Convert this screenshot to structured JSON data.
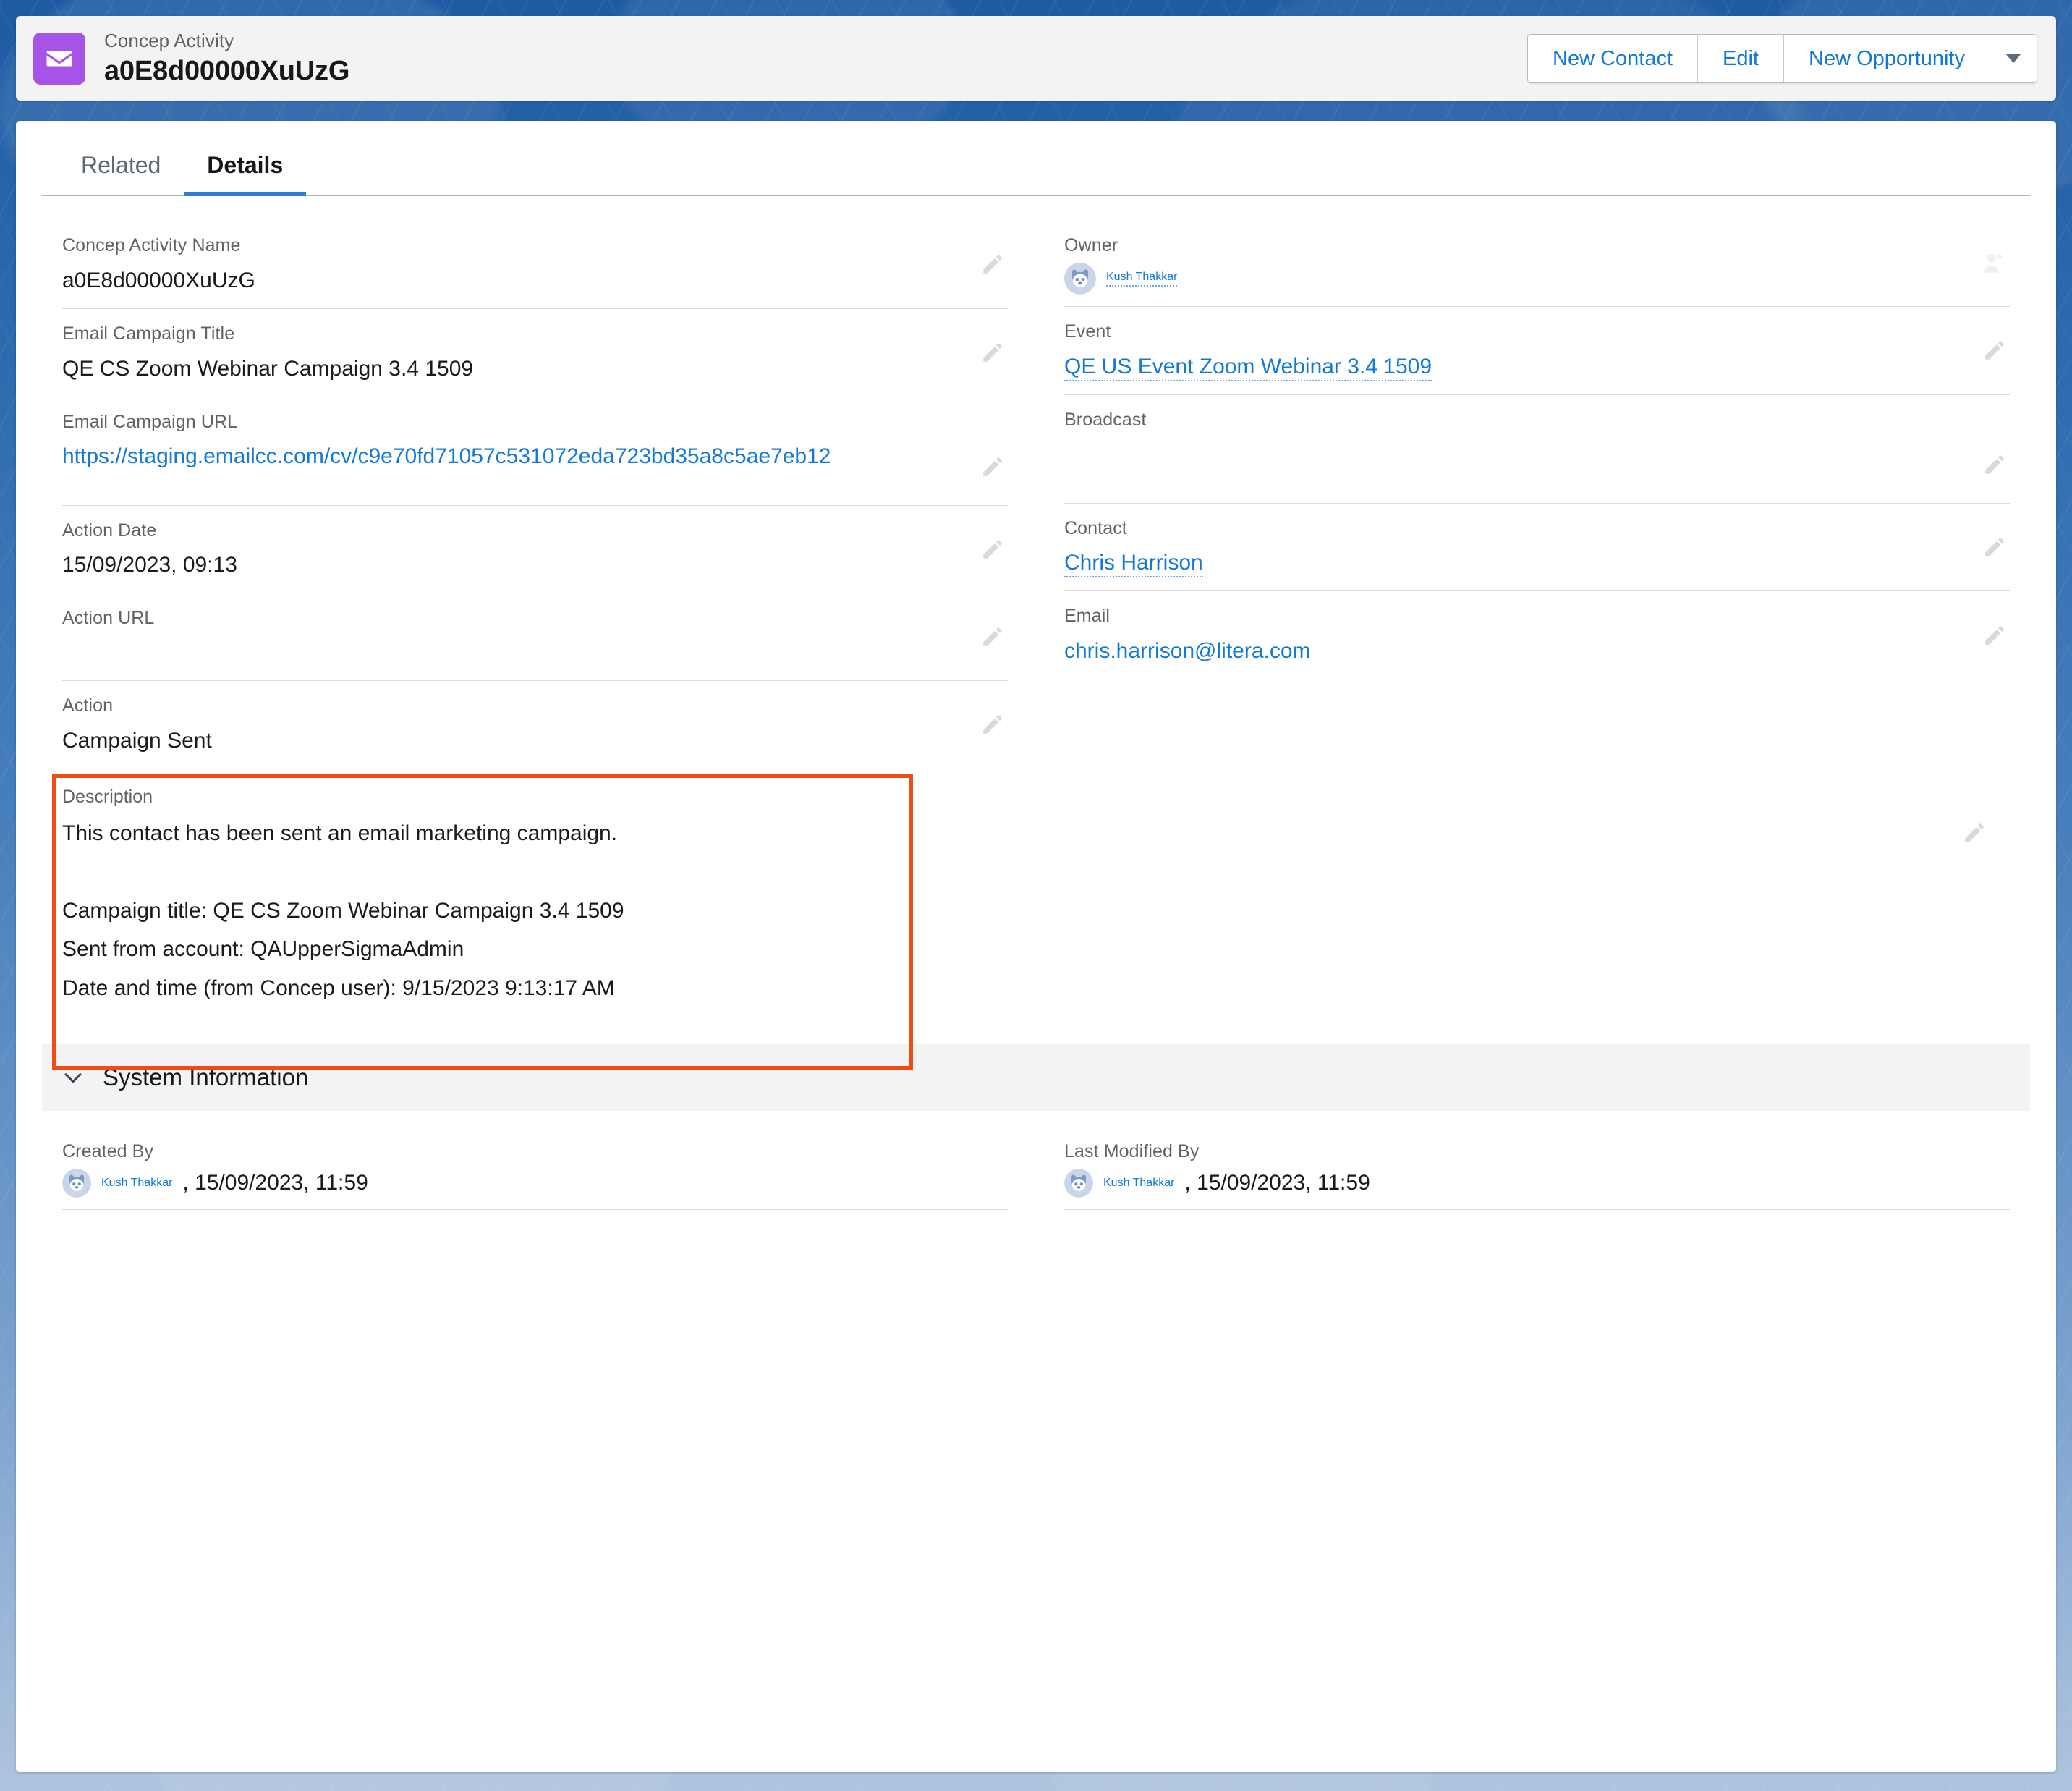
{
  "header": {
    "object_label": "Concep Activity",
    "record_title": "a0E8d00000XuUzG",
    "record_icon": "envelope-icon",
    "icon_color": "#a653e8",
    "actions": [
      {
        "label": "New Contact",
        "name": "new-contact-button"
      },
      {
        "label": "Edit",
        "name": "edit-button"
      },
      {
        "label": "New Opportunity",
        "name": "new-opportunity-button"
      }
    ],
    "more_actions_icon": "chevron-down-icon"
  },
  "tabs": [
    {
      "label": "Related",
      "active": false
    },
    {
      "label": "Details",
      "active": true
    }
  ],
  "fields": {
    "left": [
      {
        "label": "Concep Activity Name",
        "value": "a0E8d00000XuUzG",
        "type": "text",
        "editable": true
      },
      {
        "label": "Email Campaign Title",
        "value": "QE CS Zoom Webinar Campaign 3.4 1509",
        "type": "text",
        "editable": true
      },
      {
        "label": "Email Campaign URL",
        "value": "https://staging.emailcc.com/cv/c9e70fd71057c531072eda723bd35a8c5ae7eb12",
        "type": "link",
        "editable": true
      },
      {
        "label": "Action Date",
        "value": "15/09/2023, 09:13",
        "type": "text",
        "editable": true
      },
      {
        "label": "Action URL",
        "value": "",
        "type": "text",
        "editable": true
      },
      {
        "label": "Action",
        "value": "Campaign Sent",
        "type": "text",
        "editable": true
      }
    ],
    "right": [
      {
        "label": "Owner",
        "value": "Kush Thakkar",
        "type": "user",
        "editable": true,
        "edit_icon": "change-owner-icon"
      },
      {
        "label": "Event",
        "value": "QE US Event Zoom Webinar 3.4 1509",
        "type": "link",
        "editable": true
      },
      {
        "label": "Broadcast",
        "value": "",
        "type": "text",
        "editable": true
      },
      {
        "label": "Contact",
        "value": "Chris Harrison",
        "type": "link",
        "editable": true
      },
      {
        "label": "Email",
        "value": "chris.harrison@litera.com",
        "type": "link",
        "editable": true
      }
    ]
  },
  "description": {
    "label": "Description",
    "text": "This contact has been sent an email marketing campaign.\n\nCampaign title: QE CS Zoom Webinar Campaign 3.4 1509\nSent from account: QAUpperSigmaAdmin\nDate and time (from Concep user): 9/15/2023 9:13:17 AM",
    "highlight_color": "#f04a15"
  },
  "system_information": {
    "title": "System Information",
    "collapse_icon": "chevron-down-icon",
    "created_by": {
      "label": "Created By",
      "user": "Kush Thakkar",
      "timestamp": ", 15/09/2023, 11:59"
    },
    "last_modified_by": {
      "label": "Last Modified By",
      "user": "Kush Thakkar",
      "timestamp": ", 15/09/2023, 11:59"
    }
  },
  "colors": {
    "link": "#1279d6",
    "accent_tab": "#2a7cd6",
    "background": "#1f5ba3",
    "annotation": "#f04a15"
  }
}
